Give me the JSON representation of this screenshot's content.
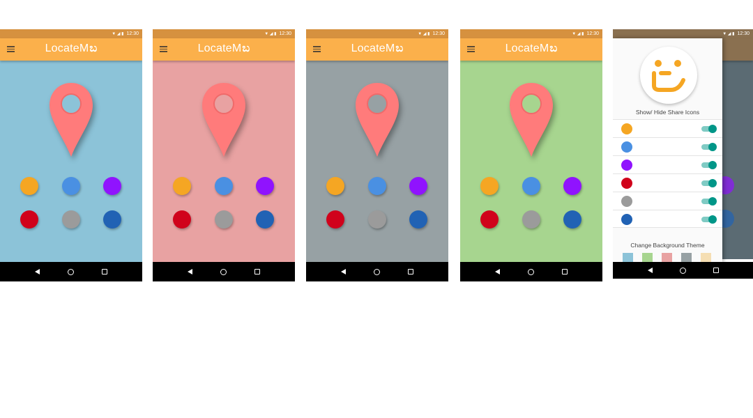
{
  "status_bar": {
    "time": "12:30",
    "signal": "▼ ◢ ▮"
  },
  "app": {
    "title": "LocateM",
    "logo_glyph": "ಬ"
  },
  "colors": {
    "accent": "#fbb04b",
    "pin": "#ff7b7b",
    "icon_colors": [
      "#f5a623",
      "#4a90e2",
      "#9013fe",
      "#d0021b",
      "#9b9b9b",
      "#2162b4"
    ]
  },
  "screens": [
    {
      "background": "#8cc3d8"
    },
    {
      "background": "#e8a2a2"
    },
    {
      "background": "#97a1a4"
    },
    {
      "background": "#a7d58f"
    }
  ],
  "drawer": {
    "share_heading": "Show/ Hide Share Icons",
    "toggles": [
      {
        "color": "#f5a623",
        "on": true
      },
      {
        "color": "#4a90e2",
        "on": true
      },
      {
        "color": "#9013fe",
        "on": true
      },
      {
        "color": "#d0021b",
        "on": true
      },
      {
        "color": "#9b9b9b",
        "on": true
      },
      {
        "color": "#2162b4",
        "on": true
      }
    ],
    "theme_heading": "Change Background Theme",
    "theme_swatches": [
      "#8cc3d8",
      "#a7d58f",
      "#e8a2a2",
      "#97a1a4",
      "#f5deb3"
    ]
  }
}
